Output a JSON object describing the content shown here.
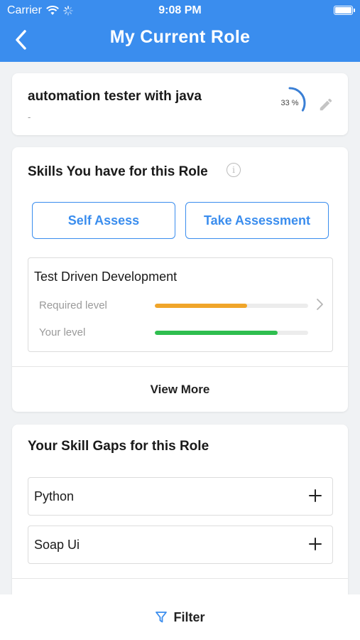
{
  "status_bar": {
    "carrier": "Carrier",
    "time": "9:08 PM"
  },
  "header": {
    "title": "My Current Role",
    "background": "#3a8dee"
  },
  "role": {
    "title": "automation tester with java",
    "subtitle": "-",
    "progress_label": "33 %",
    "progress_value": 0.33
  },
  "skills": {
    "title": "Skills You have for this Role",
    "self_assess_label": "Self Assess",
    "take_assessment_label": "Take Assessment",
    "items": [
      {
        "name": "Test Driven Development",
        "required_label": "Required level",
        "required_value": 0.6,
        "required_color": "#f0a52a",
        "your_label": "Your level",
        "your_value": 0.8,
        "your_color": "#2fbe4f"
      }
    ],
    "view_more_label": "View More"
  },
  "gaps": {
    "title": "Your Skill Gaps for this Role",
    "items": [
      {
        "label": "Python"
      },
      {
        "label": "Soap Ui"
      }
    ]
  },
  "filter": {
    "label": "Filter"
  },
  "icons": {
    "back": "chevron-left-icon",
    "edit": "pencil-icon",
    "info": "info-icon",
    "chevron": "chevron-right-icon",
    "add": "plus-icon",
    "filter": "filter-icon",
    "wifi": "wifi-icon",
    "battery": "battery-icon"
  },
  "colors": {
    "accent": "#3a8dee",
    "background": "#f0f2f4"
  }
}
